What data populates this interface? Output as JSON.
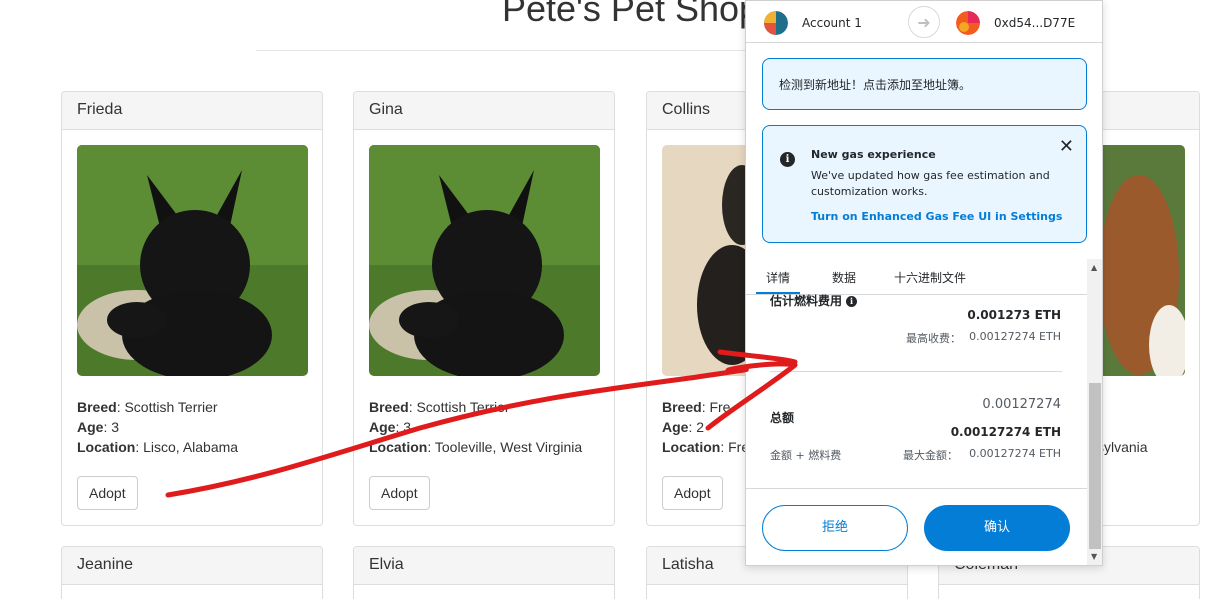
{
  "page": {
    "title": "Pete's Pet Shop"
  },
  "labels": {
    "breed": "Breed",
    "age": "Age",
    "location": "Location",
    "adopt": "Adopt"
  },
  "pets_row1": [
    {
      "name": "Frieda",
      "breed": "Scottish Terrier",
      "age": "3",
      "location": "Lisco, Alabama"
    },
    {
      "name": "Gina",
      "breed": "Scottish Terrier",
      "age": "3",
      "location": "Tooleville, West Virginia"
    },
    {
      "name": "Collins",
      "breed": "Fre",
      "age": "2",
      "location": "Fre"
    },
    {
      "name": "",
      "breed": "",
      "age": "",
      "location": "sylvania"
    }
  ],
  "pets_row2": [
    {
      "name": "Jeanine"
    },
    {
      "name": "Elvia"
    },
    {
      "name": "Latisha"
    },
    {
      "name": "Coleman"
    }
  ],
  "metamask": {
    "account_name": "Account 1",
    "to_address": "0xd54...D77E",
    "new_address_notice": "检测到新地址！点击添加至地址簿。",
    "gas_notice": {
      "title": "New gas experience",
      "body": "We've updated how gas fee estimation and customization works.",
      "link": "Turn on Enhanced Gas Fee UI in Settings"
    },
    "tabs": [
      "详情",
      "数据",
      "十六进制文件"
    ],
    "estimated_gas_label": "估计燃料费用",
    "estimated_gas_value": "0.001273 ETH",
    "max_fee_label": "最高收费：",
    "max_fee_value": "0.00127274 ETH",
    "total_label": "总额",
    "total_small": "0.00127274",
    "total_value": "0.00127274 ETH",
    "amount_plus_gas": "金额 + 燃料费",
    "max_amount_label": "最大金额：",
    "max_amount_value": "0.00127274 ETH",
    "reject_label": "拒绝",
    "confirm_label": "确认"
  },
  "colors": {
    "metamask_blue": "#037dd6",
    "notice_bg": "#eaf6ff",
    "scribble_red": "#e01b1b"
  },
  "icons": [
    "info-icon",
    "close-icon",
    "arrow-right-icon",
    "scroll-up-icon",
    "scroll-down-icon"
  ]
}
